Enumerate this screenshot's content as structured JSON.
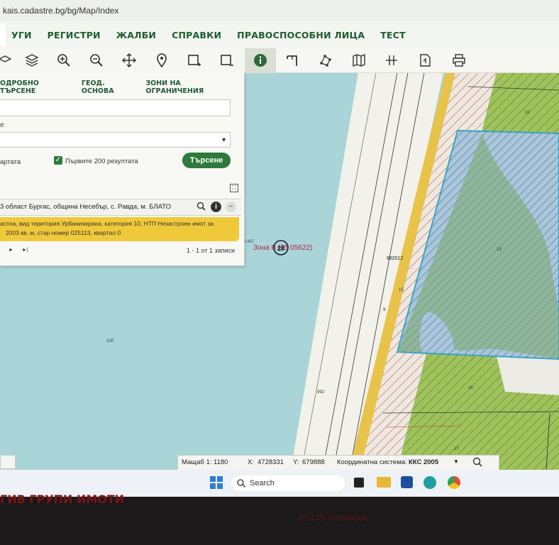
{
  "browser": {
    "url": "kais.cadastre.bg/bg/Map/Index"
  },
  "menu": {
    "items": [
      "УГИ",
      "РЕГИСТРИ",
      "ЖАЛБИ",
      "СПРАВКИ",
      "ПРАВОСПОСОБНИ ЛИЦА",
      "ТЕСТ"
    ]
  },
  "toolbar": {
    "icons": [
      "layers-icon",
      "layers-stack-icon",
      "zoom-in-icon",
      "zoom-out-icon",
      "pan-icon",
      "location-pin-icon",
      "select-rect-icon",
      "select-rect-minus-icon",
      "info-icon",
      "measure-icon",
      "polygon-icon",
      "book-map-icon",
      "crosshair-icon",
      "document-icon",
      "print-icon"
    ],
    "active": "info-icon"
  },
  "panel": {
    "tabs": [
      "ОДРОБНО ТЪРСЕНЕ",
      "ГЕОД. ОСНОВА",
      "ЗОНИ НА ОГРАНИЧЕНИЯ"
    ],
    "field_label": "е",
    "map_label": "артата",
    "checkbox_label": "Първите 200 резултата",
    "checkbox_checked": true,
    "search_button": "Търсене",
    "result_header": "3 област Бургас, община Несебър, с. Равда, м. БЛАТО",
    "result_line1": "астна, вид територия Урбанизирана, категория 10, НТП Незастроен имот за",
    "result_line2": "2003 кв. м, стар номер 025113, квартал 0",
    "pager_next": "►",
    "pager_last": "►|",
    "pager_info": "1 - 1 от 1 записи"
  },
  "map_labels": {
    "zone": "Зона В (25 05622)",
    "zone_circle": "28",
    "small_id": "1487",
    "num_100": "100",
    "num_992": "992",
    "num_9": "9",
    "num_15": "15",
    "num_992012": "992012",
    "num_13": "13",
    "num_10": "10",
    "num_16": "16",
    "num_17": "17"
  },
  "statusbar": {
    "scale_label": "Мащаб 1:",
    "scale_value": "1180",
    "x_label": "X:",
    "x_value": "4728331",
    "y_label": "Y:",
    "y_value": "679888",
    "coord_label": "Координатна система:",
    "coord_value": "ККС 2005"
  },
  "taskbar": {
    "search": "Search"
  },
  "overlay": {
    "red_text": "ГИВ ГРУПИ ИМОТИ",
    "brand": "ASUS Vivobook"
  },
  "colors": {
    "menu_green": "#1e5c33",
    "button_green": "#2d7a3a",
    "highlight_yellow": "#f0c93a",
    "water": "#a9d4d8",
    "parcel_blue": "#9fc6e0",
    "field_green": "#9fc25a"
  }
}
